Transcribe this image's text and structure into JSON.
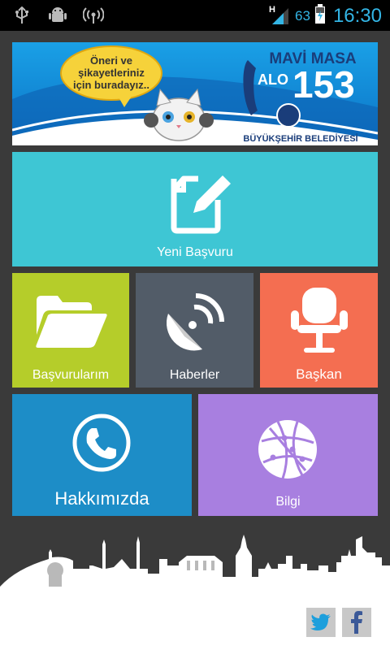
{
  "status_bar": {
    "icons_left": [
      "usb-icon",
      "android-debug-icon",
      "wifi-hotspot-icon"
    ],
    "network_type": "H",
    "battery_percent": "63",
    "time": "16:30",
    "accent_color": "#33b5e5"
  },
  "banner": {
    "bubble_text_line1": "Öneri ve",
    "bubble_text_line2": "şikayetleriniz",
    "bubble_text_line3": "için buradayız..",
    "title": "MAVİ MASA",
    "alo": "ALO",
    "number": "153",
    "org": "BÜYÜKŞEHİR BELEDİYESİ"
  },
  "tiles": {
    "new_application": {
      "label": "Yeni Başvuru",
      "color": "#3ec6d4",
      "icon": "edit-document-icon"
    },
    "my_applications": {
      "label": "Başvurularım",
      "color": "#b5cd2a",
      "icon": "folder-open-icon"
    },
    "news": {
      "label": "Haberler",
      "color": "#525c68",
      "icon": "satellite-dish-icon"
    },
    "mayor": {
      "label": "Başkan",
      "color": "#f46e51",
      "icon": "office-chair-icon"
    },
    "about": {
      "label": "Hakkımızda",
      "color": "#1d8dc7",
      "icon": "phone-icon"
    },
    "info": {
      "label": "Bilgi",
      "color": "#a87fe0",
      "icon": "globe-network-icon"
    }
  },
  "footer": {
    "twitter_icon": "twitter-icon",
    "facebook_icon": "facebook-icon"
  }
}
